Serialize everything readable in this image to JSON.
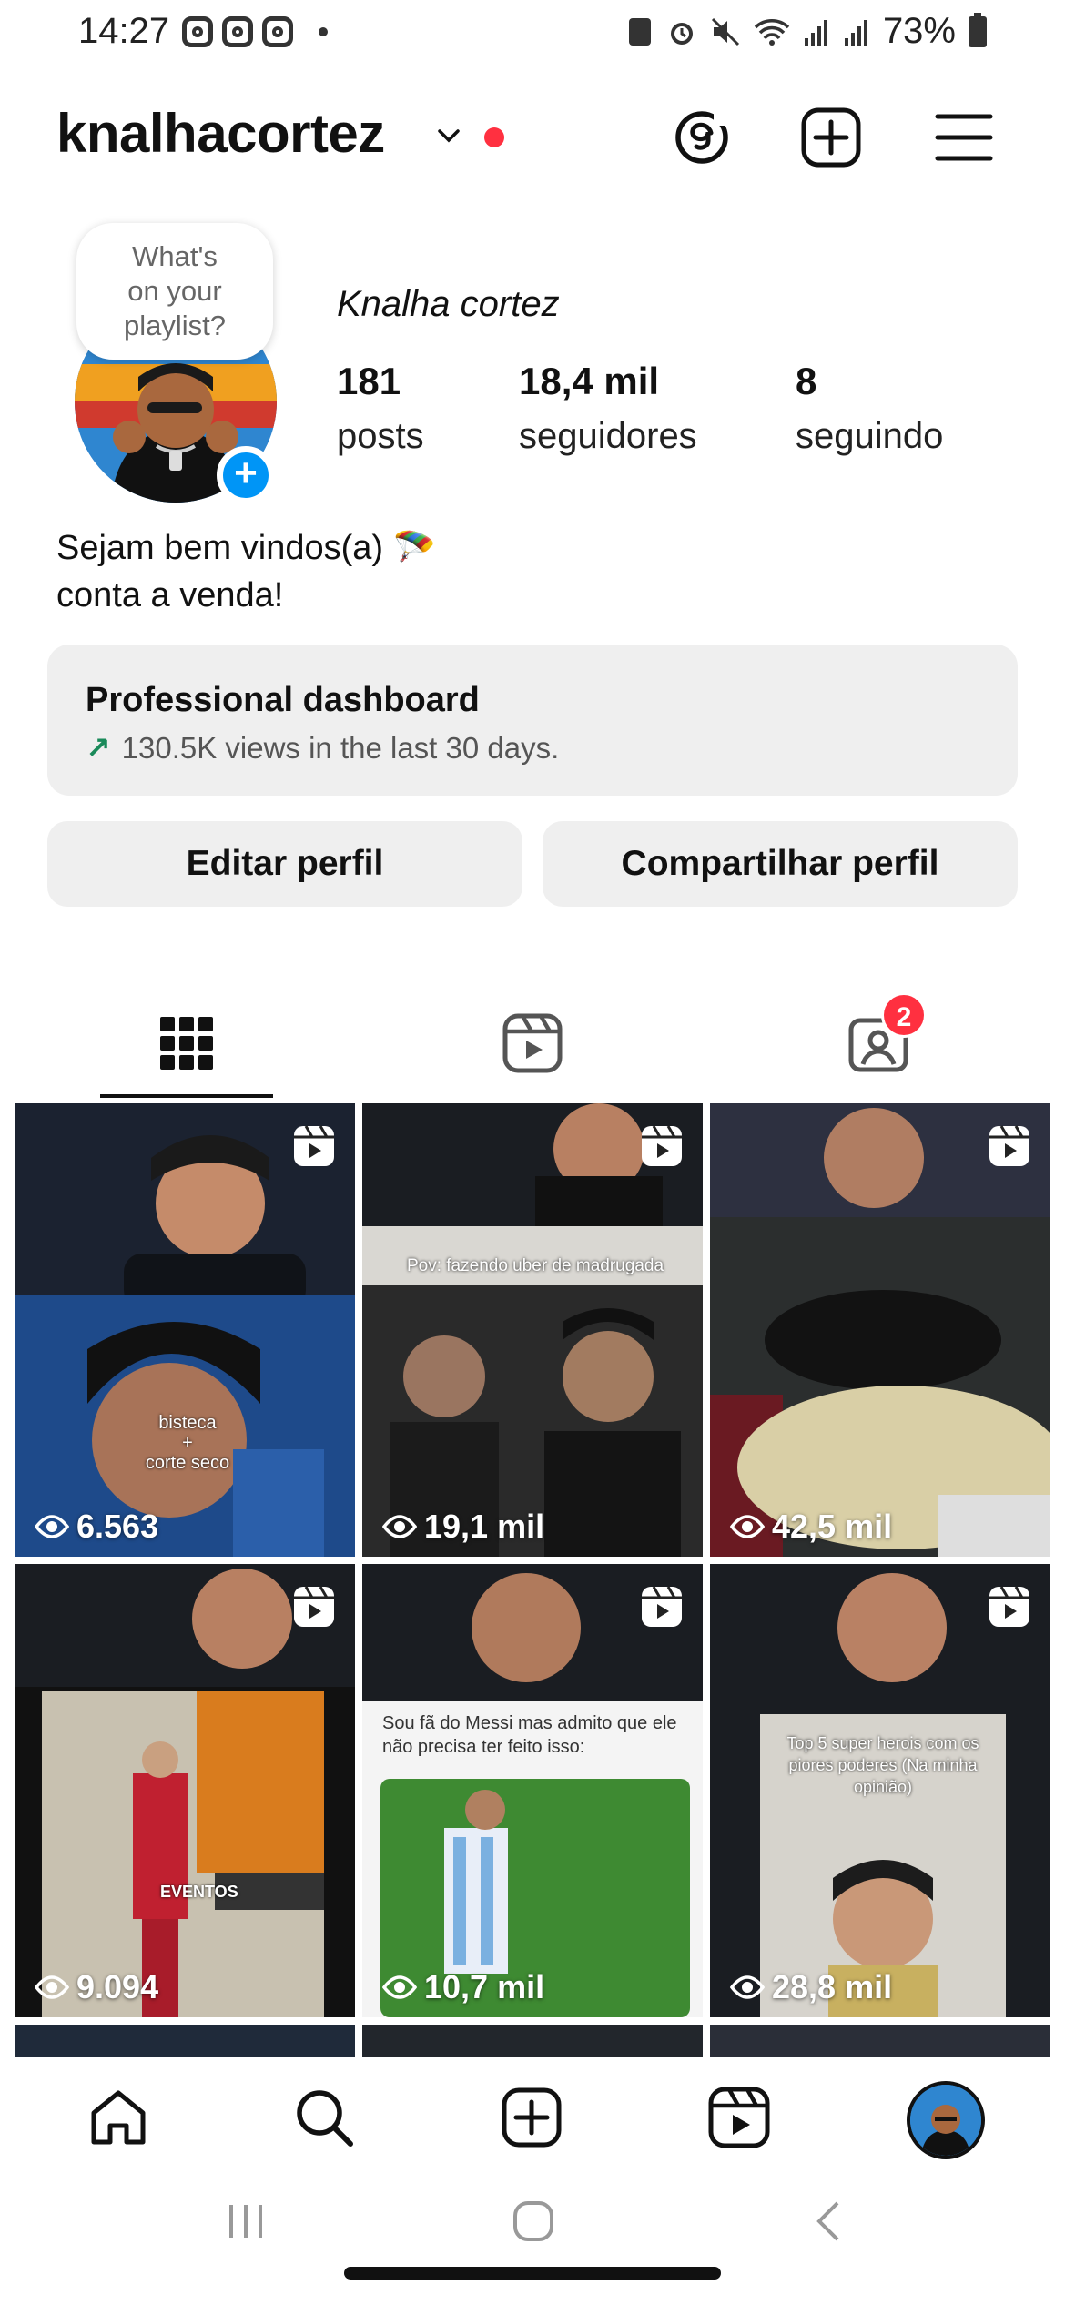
{
  "status_bar": {
    "time": "14:27",
    "battery": "73%"
  },
  "header": {
    "username": "knalhacortez",
    "icons": [
      "chevron-down-icon",
      "threads-icon",
      "create-icon",
      "menu-icon"
    ]
  },
  "profile": {
    "note_line1": "What's",
    "note_line2": "on your",
    "note_line3": "playlist?",
    "full_name": "Knalha cortez",
    "stats": [
      {
        "value": "181",
        "label": "posts"
      },
      {
        "value": "18,4 mil",
        "label": "seguidores"
      },
      {
        "value": "8",
        "label": "seguindo"
      }
    ],
    "bio_line1": "Sejam bem vindos(a) 🪂",
    "bio_line2": "conta a venda!"
  },
  "dashboard": {
    "title": "Professional dashboard",
    "arrow": "↗",
    "subtitle": "130.5K views in the last 30 days."
  },
  "buttons": {
    "edit": "Editar perfil",
    "share": "Compartilhar perfil"
  },
  "tabs": {
    "tagged_badge": "2"
  },
  "grid": [
    {
      "views": "6.563",
      "caption": "bisteca\n+\ncorte seco"
    },
    {
      "views": "19,1 mil",
      "caption": "Pov: fazendo uber de madrugada"
    },
    {
      "views": "42,5 mil",
      "caption": ""
    },
    {
      "views": "9.094",
      "caption": "EVENTOS"
    },
    {
      "views": "10,7 mil",
      "caption": "Sou fã do Messi mas admito que ele não precisa ter feito isso:"
    },
    {
      "views": "28,8 mil",
      "caption": "Top 5 super herois com os piores poderes (Na minha opinião)"
    }
  ],
  "colors": {
    "accent_blue": "#0095f6",
    "notification_red": "#ff3040",
    "button_bg": "#efefef",
    "trend_green": "#1a8a5a"
  }
}
